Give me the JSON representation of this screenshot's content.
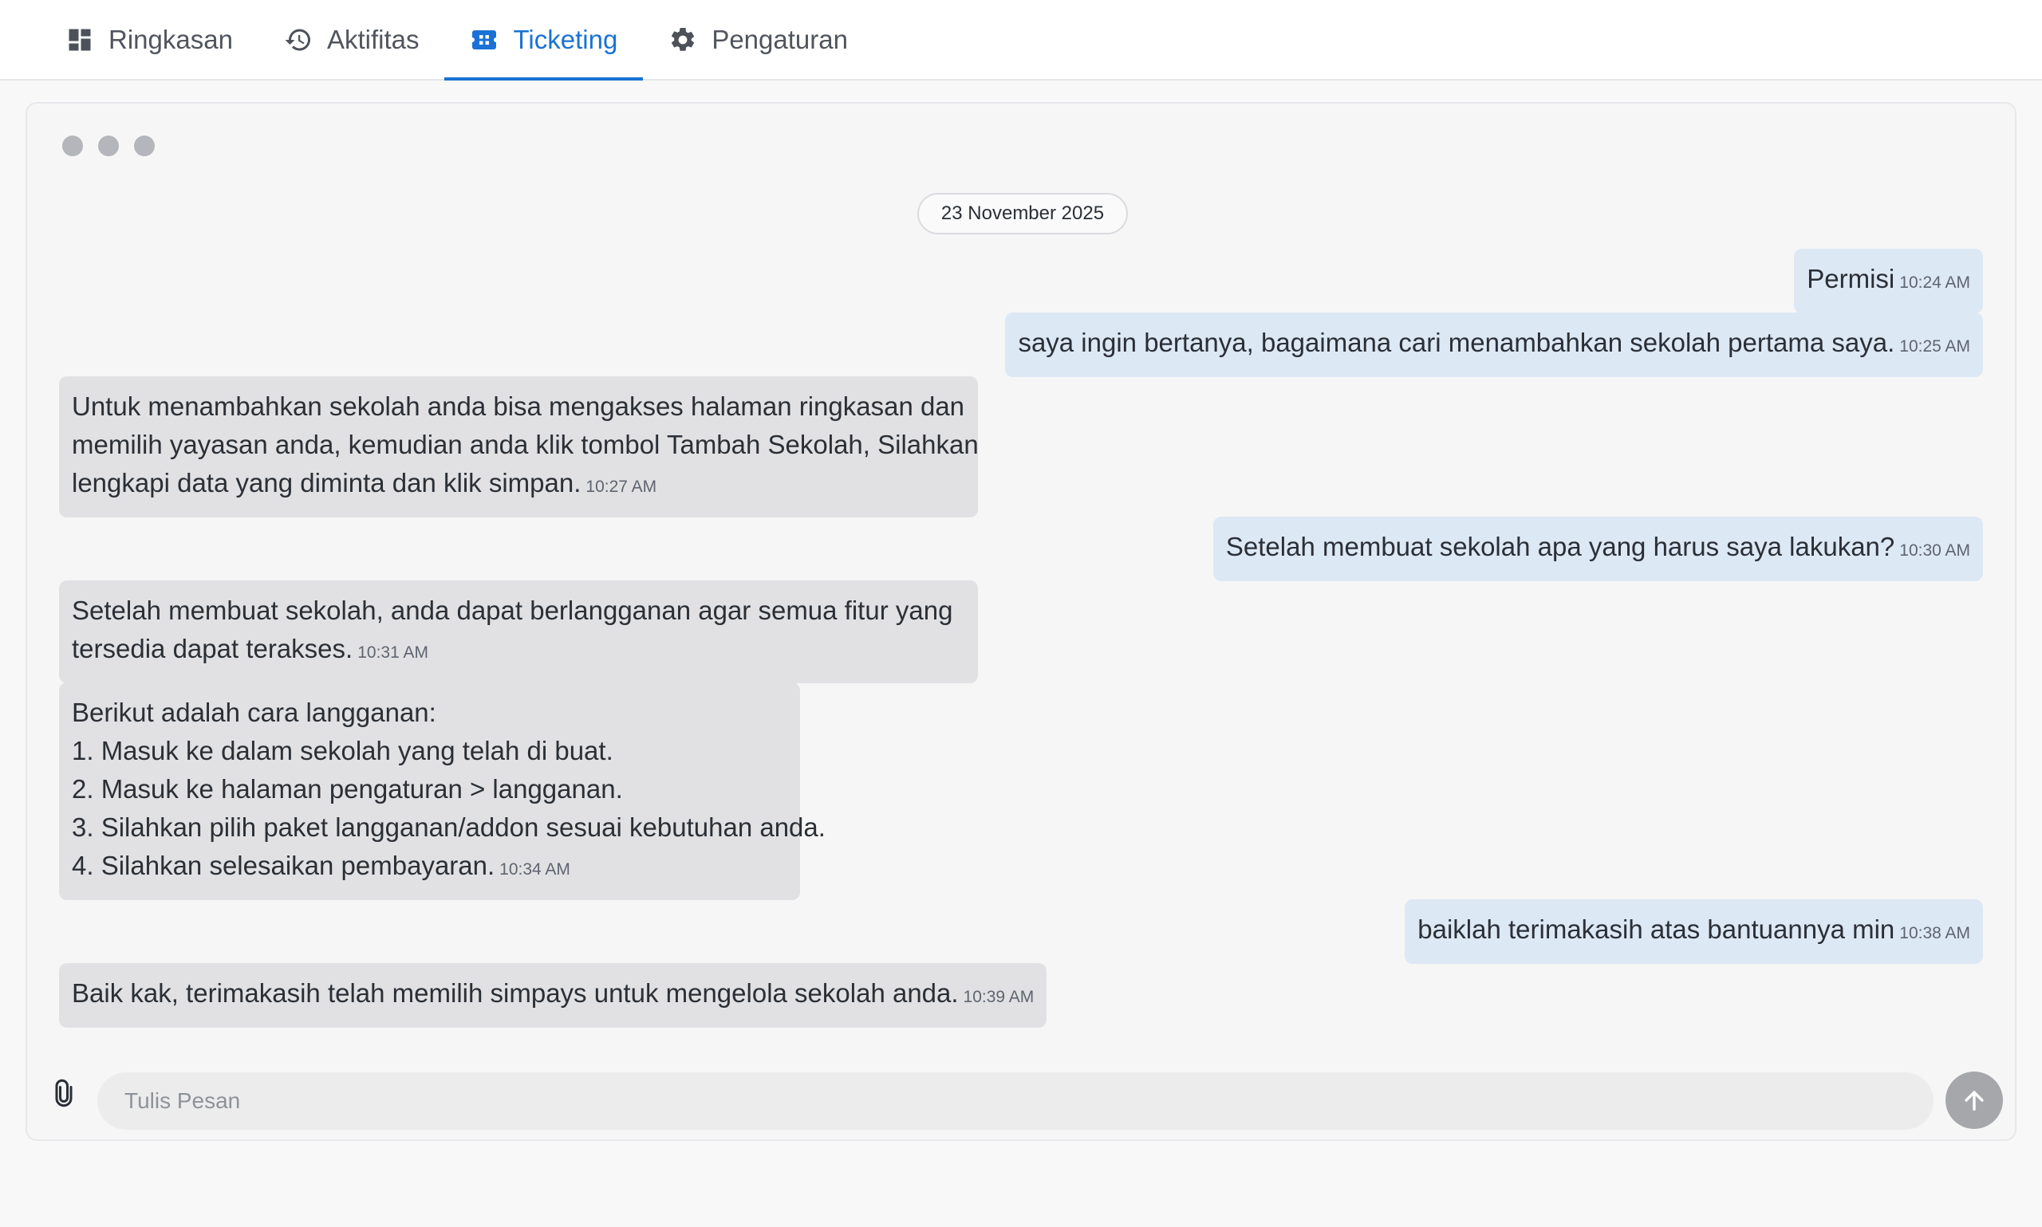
{
  "tabs": [
    {
      "label": "Ringkasan",
      "icon": "dashboard-icon",
      "active": false
    },
    {
      "label": "Aktifitas",
      "icon": "history-icon",
      "active": false
    },
    {
      "label": "Ticketing",
      "icon": "ticket-icon",
      "active": true
    },
    {
      "label": "Pengaturan",
      "icon": "gear-icon",
      "active": false
    }
  ],
  "chat": {
    "date": "23 November 2025",
    "messages": [
      {
        "from": "me",
        "lines": [
          "Permisi"
        ],
        "time": "10:24 AM"
      },
      {
        "from": "me",
        "lines": [
          "saya ingin bertanya, bagaimana cari menambahkan sekolah pertama saya."
        ],
        "time": "10:25 AM"
      },
      {
        "from": "them",
        "lines": [
          "Untuk menambahkan sekolah anda bisa mengakses halaman ringkasan dan",
          "memilih yayasan anda, kemudian anda klik tombol Tambah Sekolah, Silahkan",
          "lengkapi data yang diminta dan klik simpan."
        ],
        "time": "10:27 AM"
      },
      {
        "from": "me",
        "lines": [
          "Setelah membuat sekolah apa yang harus saya lakukan?"
        ],
        "time": "10:30 AM"
      },
      {
        "from": "them",
        "lines": [
          "Setelah membuat sekolah, anda dapat berlangganan agar semua fitur yang",
          "tersedia dapat terakses."
        ],
        "time": "10:31 AM"
      },
      {
        "from": "them",
        "lines": [
          "Berikut adalah cara langganan:",
          "1. Masuk ke dalam sekolah yang telah di buat.",
          "2. Masuk ke halaman pengaturan > langganan.",
          "3. Silahkan pilih paket langganan/addon sesuai kebutuhan anda.",
          "4. Silahkan selesaikan pembayaran."
        ],
        "time": "10:34 AM"
      },
      {
        "from": "me",
        "lines": [
          "baiklah terimakasih atas bantuannya min"
        ],
        "time": "10:38 AM"
      },
      {
        "from": "them",
        "lines": [
          "Baik kak, terimakasih telah memilih simpays untuk mengelola sekolah anda."
        ],
        "time": "10:39 AM"
      }
    ]
  },
  "composer": {
    "placeholder": "Tulis Pesan",
    "value": "",
    "attach_icon": "paperclip-icon",
    "send_icon": "arrow-up-icon"
  },
  "colors": {
    "accent": "#1a72d6",
    "my_bubble": "#dde8f5",
    "their_bubble": "#e1e1e3"
  }
}
